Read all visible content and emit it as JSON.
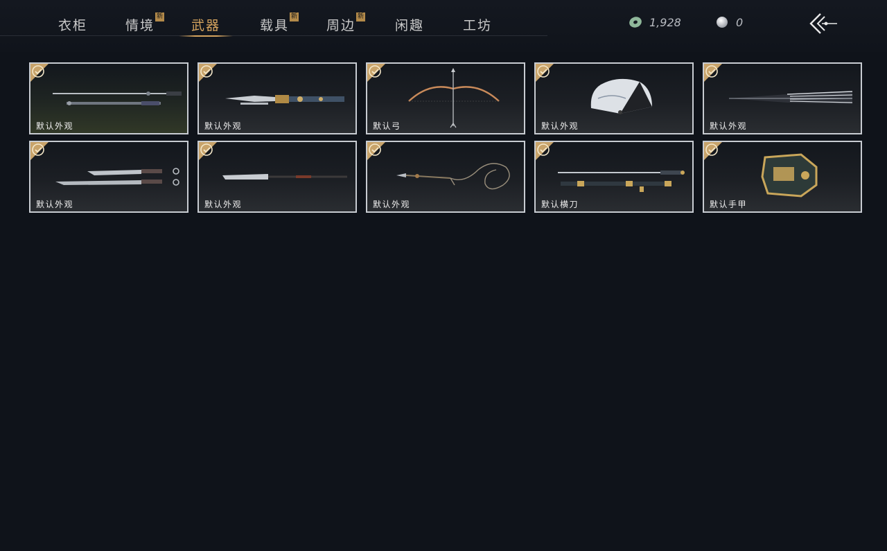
{
  "tabs": [
    {
      "label": "衣柜",
      "new": false,
      "active": false
    },
    {
      "label": "情境",
      "new": true,
      "active": false
    },
    {
      "label": "武器",
      "new": false,
      "active": true
    },
    {
      "label": "载具",
      "new": true,
      "active": false
    },
    {
      "label": "周边",
      "new": true,
      "active": false
    },
    {
      "label": "闲趣",
      "new": false,
      "active": false
    },
    {
      "label": "工坊",
      "new": false,
      "active": false
    }
  ],
  "new_badge": "新",
  "currency": {
    "jade": {
      "icon": "jade-coin-icon",
      "value": "1,928"
    },
    "pearl": {
      "icon": "pearl-icon",
      "value": "0"
    }
  },
  "back_icon": "back-arrow-icon",
  "items": [
    {
      "label": "默认外观",
      "art": "twin-sword-and-spear",
      "equipped": true
    },
    {
      "label": "默认外观",
      "art": "ornate-blade",
      "equipped": true
    },
    {
      "label": "默认弓",
      "art": "bow-and-arrow",
      "equipped": true
    },
    {
      "label": "默认外观",
      "art": "folding-fan",
      "equipped": true
    },
    {
      "label": "默认外观",
      "art": "umbrella",
      "equipped": true
    },
    {
      "label": "默认外观",
      "art": "twin-sabers",
      "equipped": true
    },
    {
      "label": "默认外观",
      "art": "glaive",
      "equipped": true
    },
    {
      "label": "默认外观",
      "art": "rope-dart",
      "equipped": true
    },
    {
      "label": "默认横刀",
      "art": "hengdao-sword",
      "equipped": true
    },
    {
      "label": "默认手甲",
      "art": "gauntlet",
      "equipped": true
    }
  ],
  "colors": {
    "accent": "#d6a45e",
    "badge": "#b38a4a",
    "card_border": "#c8ccd2",
    "background": "#0f131a"
  }
}
